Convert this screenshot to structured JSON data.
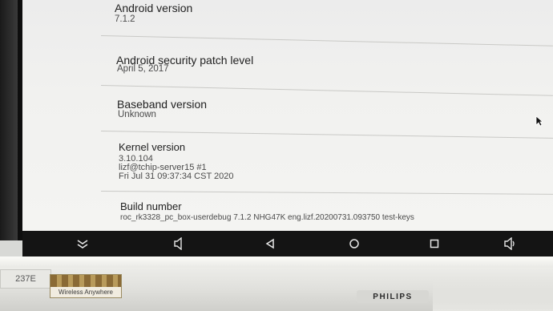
{
  "settings": [
    {
      "title": "Android version",
      "values": [
        "7.1.2"
      ]
    },
    {
      "title": "Android security patch level",
      "values": [
        "April 5, 2017"
      ]
    },
    {
      "title": "Baseband version",
      "values": [
        "Unknown"
      ]
    },
    {
      "title": "Kernel version",
      "values": [
        "3.10.104",
        "lizf@tchip-server15 #1",
        "Fri Jul 31 09:37:34 CST 2020"
      ]
    },
    {
      "title": "Build number",
      "values": [
        "roc_rk3328_pc_box-userdebug 7.1.2 NHG47K eng.lizf.20200731.093750 test-keys"
      ]
    }
  ],
  "navbar": {
    "icons": [
      "chevron-down-icon",
      "volume-down-icon",
      "back-icon",
      "home-icon",
      "recents-icon",
      "volume-up-icon"
    ]
  },
  "monitor": {
    "model": "237E",
    "sticker_text": "Wireless Anywhere",
    "brand": "PHILIPS"
  }
}
